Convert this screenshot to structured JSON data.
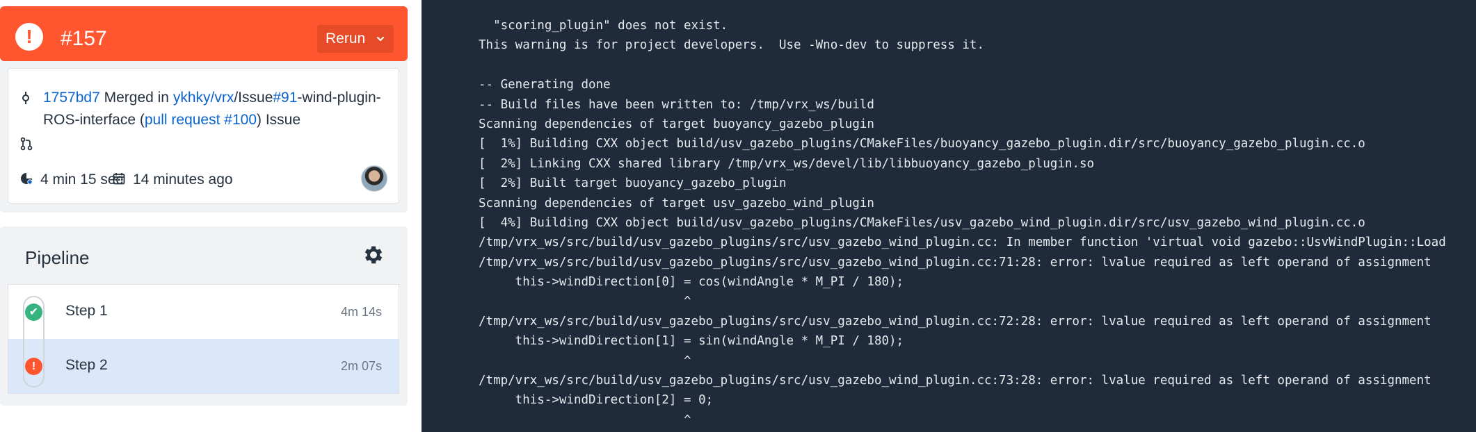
{
  "header": {
    "status_icon": "exclamation-icon",
    "status_symbol": "!",
    "build_number": "#157",
    "rerun_label": "Rerun",
    "color": "#ff5630"
  },
  "commit": {
    "sha": "1757bd7",
    "merged_in": " Merged in ",
    "repo": "ykhky/vrx",
    "branch_prefix": "/Issue",
    "issue_ref": "#91",
    "branch_suffix": "-wind-plugin-ROS-interface (",
    "pr_label": "pull request #100",
    "trailing": ") Issue",
    "duration": "4 min 15 sec",
    "time_ago": "14 minutes ago"
  },
  "pipeline": {
    "title": "Pipeline",
    "steps": [
      {
        "label": "Step 1",
        "time": "4m 14s",
        "status": "success",
        "color": "#36b37e",
        "symbol": "✔"
      },
      {
        "label": "Step 2",
        "time": "2m 07s",
        "status": "failed",
        "color": "#ff5630",
        "symbol": "!"
      }
    ]
  },
  "log": {
    "lines": [
      "  \"scoring_plugin\" does not exist.",
      "This warning is for project developers.  Use -Wno-dev to suppress it.",
      "",
      "-- Generating done",
      "-- Build files have been written to: /tmp/vrx_ws/build",
      "Scanning dependencies of target buoyancy_gazebo_plugin",
      "[  1%] Building CXX object build/usv_gazebo_plugins/CMakeFiles/buoyancy_gazebo_plugin.dir/src/buoyancy_gazebo_plugin.cc.o",
      "[  2%] Linking CXX shared library /tmp/vrx_ws/devel/lib/libbuoyancy_gazebo_plugin.so",
      "[  2%] Built target buoyancy_gazebo_plugin",
      "Scanning dependencies of target usv_gazebo_wind_plugin",
      "[  4%] Building CXX object build/usv_gazebo_plugins/CMakeFiles/usv_gazebo_wind_plugin.dir/src/usv_gazebo_wind_plugin.cc.o",
      "/tmp/vrx_ws/src/build/usv_gazebo_plugins/src/usv_gazebo_wind_plugin.cc: In member function 'virtual void gazebo::UsvWindPlugin::Load",
      "/tmp/vrx_ws/src/build/usv_gazebo_plugins/src/usv_gazebo_wind_plugin.cc:71:28: error: lvalue required as left operand of assignment",
      "     this->windDirection[0] = cos(windAngle * M_PI / 180);",
      "                            ^",
      "/tmp/vrx_ws/src/build/usv_gazebo_plugins/src/usv_gazebo_wind_plugin.cc:72:28: error: lvalue required as left operand of assignment",
      "     this->windDirection[1] = sin(windAngle * M_PI / 180);",
      "                            ^",
      "/tmp/vrx_ws/src/build/usv_gazebo_plugins/src/usv_gazebo_wind_plugin.cc:73:28: error: lvalue required as left operand of assignment",
      "     this->windDirection[2] = 0;",
      "                            ^"
    ]
  }
}
